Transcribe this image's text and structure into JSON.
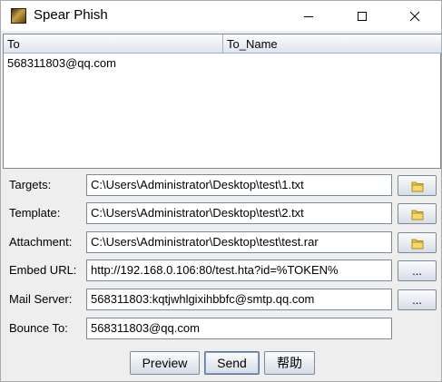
{
  "window": {
    "title": "Spear Phish",
    "icon": "spear-phish-app-icon"
  },
  "table": {
    "columns": [
      "To",
      "To_Name"
    ],
    "rows": [
      [
        "568311803@qq.com",
        ""
      ]
    ]
  },
  "form": {
    "targets": {
      "label": "Targets:",
      "value": "C:\\Users\\Administrator\\Desktop\\test\\1.txt"
    },
    "template": {
      "label": "Template:",
      "value": "C:\\Users\\Administrator\\Desktop\\test\\2.txt"
    },
    "attachment": {
      "label": "Attachment:",
      "value": "C:\\Users\\Administrator\\Desktop\\test\\test.rar"
    },
    "embed_url": {
      "label": "Embed URL:",
      "value": "http://192.168.0.106:80/test.hta?id=%TOKEN%",
      "button": "..."
    },
    "mail_server": {
      "label": "Mail Server:",
      "value": "568311803:kqtjwhlgixihbbfc@smtp.qq.com",
      "button": "..."
    },
    "bounce_to": {
      "label": "Bounce To:",
      "value": "568311803@qq.com"
    }
  },
  "buttons": {
    "preview": "Preview",
    "send": "Send",
    "help": "帮助"
  },
  "colors": {
    "folder": "#f2c94c",
    "focus": "#7da2ce"
  }
}
